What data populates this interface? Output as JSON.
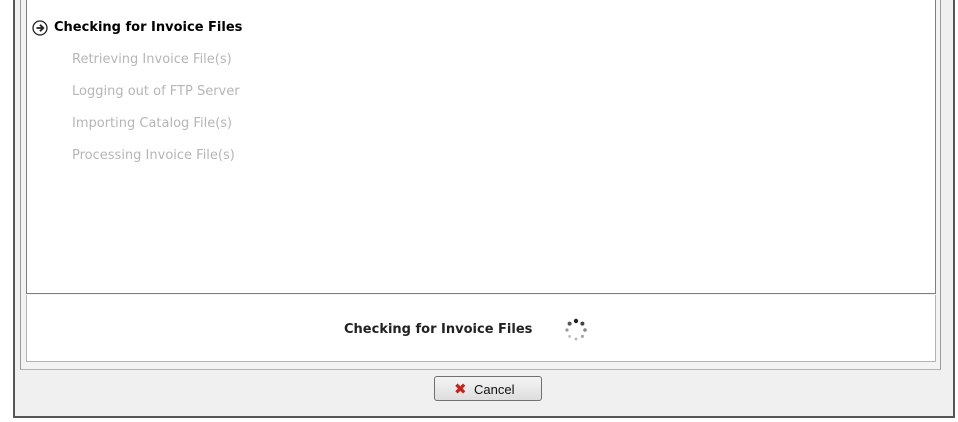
{
  "steps": [
    {
      "label": "Checking for Invoice Files",
      "state": "active"
    },
    {
      "label": "Retrieving Invoice File(s)",
      "state": "pending"
    },
    {
      "label": "Logging out of FTP Server",
      "state": "pending"
    },
    {
      "label": "Importing Catalog File(s)",
      "state": "pending"
    },
    {
      "label": "Processing Invoice File(s)",
      "state": "pending"
    }
  ],
  "status": {
    "text": "Checking for Invoice Files",
    "icon": "loading-spinner-icon"
  },
  "icons": {
    "active_step": "arrow-right-circle-icon",
    "cancel": "red-x-icon"
  },
  "cancel_button": {
    "label": "Cancel"
  },
  "colors": {
    "active_text": "#000000",
    "pending_text": "#b6b6b6",
    "cancel_icon": "#c0251f"
  }
}
